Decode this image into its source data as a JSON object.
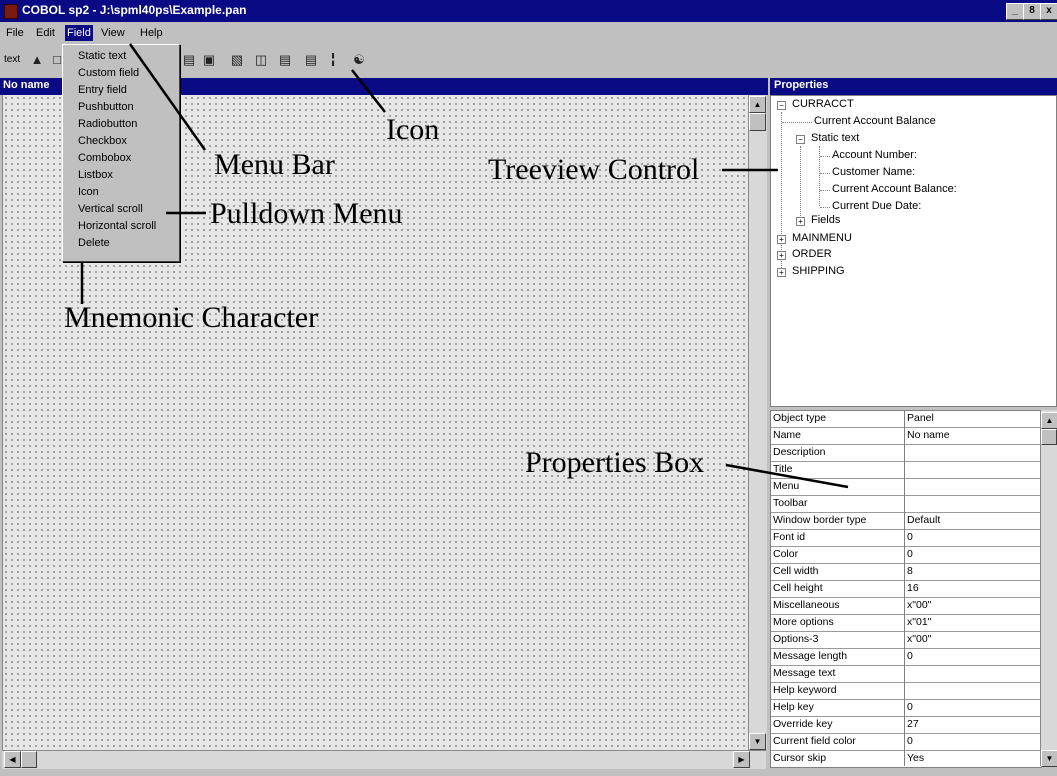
{
  "window": {
    "title": "COBOL sp2 - J:\\spml40ps\\Example.pan",
    "minimize": "_",
    "maximize": "8",
    "close": "x"
  },
  "menubar": [
    "File",
    "Edit",
    "Field",
    "View",
    "Help"
  ],
  "toolbar": {
    "text_label": "text"
  },
  "design_panel": {
    "title": "No name"
  },
  "field_menu": [
    "Static text",
    "Custom field",
    "Entry field",
    "Pushbutton",
    "Radiobutton",
    "Checkbox",
    "Combobox",
    "Listbox",
    "Icon",
    "Vertical scroll",
    "Horizontal scroll",
    "Delete"
  ],
  "properties": {
    "title": "Properties",
    "tree": {
      "root": "CURRACCT",
      "current_account_balance": "Current Account Balance",
      "static_text": "Static text",
      "static_children": [
        "Account Number:",
        "Customer Name:",
        "Current Account Balance:",
        "Current Due Date:"
      ],
      "fields": "Fields",
      "others": [
        "MAINMENU",
        "ORDER",
        "SHIPPING"
      ]
    },
    "grid": [
      {
        "name": "Object type",
        "value": "Panel"
      },
      {
        "name": "Name",
        "value": "No name"
      },
      {
        "name": "Description",
        "value": ""
      },
      {
        "name": "Title",
        "value": ""
      },
      {
        "name": "Menu",
        "value": ""
      },
      {
        "name": "Toolbar",
        "value": ""
      },
      {
        "name": "Window border type",
        "value": "Default"
      },
      {
        "name": "Font id",
        "value": "0"
      },
      {
        "name": "Color",
        "value": "0"
      },
      {
        "name": "Cell width",
        "value": "8"
      },
      {
        "name": "Cell height",
        "value": "16"
      },
      {
        "name": "Miscellaneous",
        "value": "x\"00\""
      },
      {
        "name": "More options",
        "value": "x\"01\""
      },
      {
        "name": "Options-3",
        "value": "x\"00\""
      },
      {
        "name": "Message length",
        "value": "0"
      },
      {
        "name": "Message text",
        "value": ""
      },
      {
        "name": "Help keyword",
        "value": ""
      },
      {
        "name": "Help key",
        "value": "0"
      },
      {
        "name": "Override key",
        "value": "27"
      },
      {
        "name": "Current field color",
        "value": "0"
      },
      {
        "name": "Cursor skip",
        "value": "Yes"
      }
    ]
  },
  "annotations": {
    "icon": "Icon",
    "menu_bar": "Menu Bar",
    "treeview": "Treeview Control",
    "pulldown": "Pulldown Menu",
    "mnemonic": "Mnemonic Character",
    "properties_box": "Properties Box"
  }
}
